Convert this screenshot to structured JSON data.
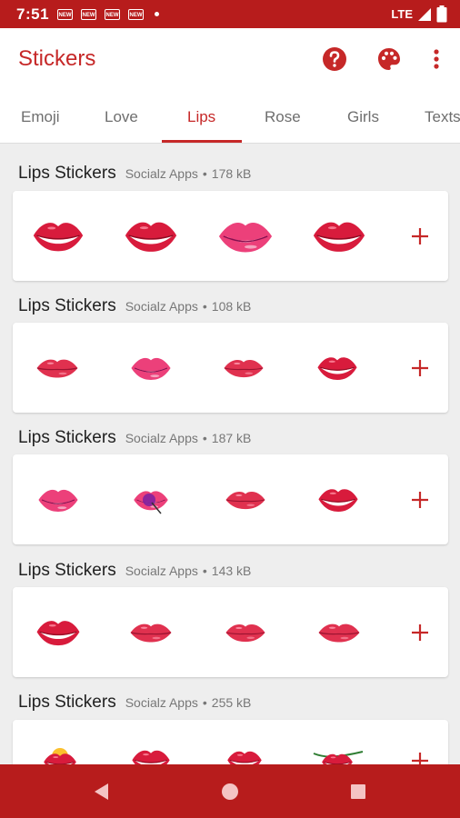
{
  "status_bar": {
    "time": "7:51",
    "network": "LTE",
    "notification_icons": [
      "NEW",
      "NEW",
      "NEW",
      "NEW"
    ]
  },
  "app_bar": {
    "title": "Stickers",
    "actions": [
      "help-icon",
      "palette-icon",
      "more-vert-icon"
    ]
  },
  "tabs": [
    {
      "label": "Emoji",
      "active": false
    },
    {
      "label": "Love",
      "active": false
    },
    {
      "label": "Lips",
      "active": true
    },
    {
      "label": "Rose",
      "active": false
    },
    {
      "label": "Girls",
      "active": false
    },
    {
      "label": "Texts",
      "active": false
    }
  ],
  "packs": [
    {
      "title": "Lips Stickers",
      "author": "Socialz Apps",
      "size": "178 kB",
      "sticker_count": 4
    },
    {
      "title": "Lips Stickers",
      "author": "Socialz Apps",
      "size": "108 kB",
      "sticker_count": 4
    },
    {
      "title": "Lips Stickers",
      "author": "Socialz Apps",
      "size": "187 kB",
      "sticker_count": 4
    },
    {
      "title": "Lips Stickers",
      "author": "Socialz Apps",
      "size": "143 kB",
      "sticker_count": 4
    },
    {
      "title": "Lips Stickers",
      "author": "Socialz Apps",
      "size": "255 kB",
      "sticker_count": 4
    }
  ],
  "meta_separator": "•",
  "add_label": "+",
  "colors": {
    "primary": "#c62828",
    "status_bar": "#b71c1c",
    "tab_inactive": "#6e6e6e",
    "background": "#eeeeee"
  },
  "navigation": [
    "back-icon",
    "home-icon",
    "recents-icon"
  ]
}
